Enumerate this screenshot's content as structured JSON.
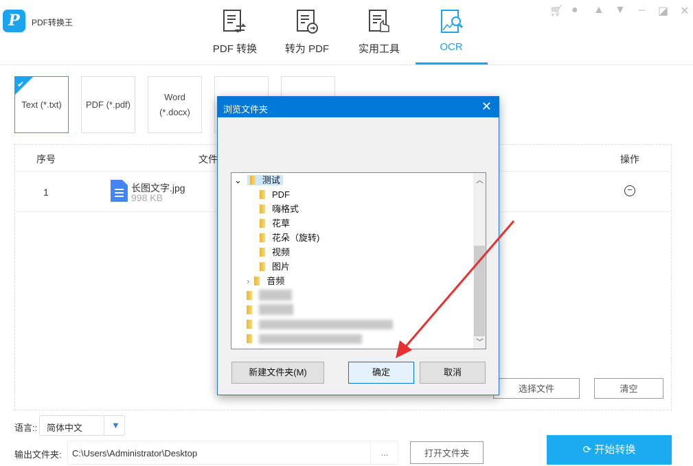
{
  "app": {
    "name": "PDF转换王",
    "logo_letter": "P"
  },
  "nav": [
    {
      "label": "PDF 转换"
    },
    {
      "label": "转为 PDF"
    },
    {
      "label": "实用工具"
    },
    {
      "label": "OCR",
      "active": true
    }
  ],
  "window_controls": [
    "cart-icon",
    "user-icon",
    "bell-icon",
    "menu-icon",
    "minimize-icon",
    "restore-icon",
    "close-icon"
  ],
  "formats": [
    {
      "label": "Text (*.txt)",
      "selected": true
    },
    {
      "label": "PDF (*.pdf)"
    },
    {
      "label": "Word\n(*.docx)"
    }
  ],
  "table": {
    "headers": {
      "index": "序号",
      "file": "文件",
      "action": "操作"
    },
    "rows": [
      {
        "index": "1",
        "name": "长图文字.jpg",
        "size": "998 KB"
      }
    ]
  },
  "buttons": {
    "select_file": "选择文件",
    "clear": "清空",
    "open_folder": "打开文件夹",
    "start": "开始转换",
    "browse": "..."
  },
  "language": {
    "label": "语言::",
    "value": "简体中文"
  },
  "output": {
    "label": "输出文件夹:",
    "path": "C:\\Users\\Administrator\\Desktop"
  },
  "dialog": {
    "title": "浏览文件夹",
    "close": "✕",
    "tree": [
      {
        "label": "测试",
        "expanded": true,
        "selected": true
      },
      {
        "label": "PDF"
      },
      {
        "label": "嗨格式"
      },
      {
        "label": "花草"
      },
      {
        "label": "花朵（旋转)"
      },
      {
        "label": "视频"
      },
      {
        "label": "图片"
      },
      {
        "label": "音频",
        "collapsed": true
      }
    ],
    "new_folder": "新建文件夹(M)",
    "ok": "确定",
    "cancel": "取消"
  },
  "colors": {
    "accent": "#1aa3f0",
    "dialog_title": "#0078d7",
    "arrow": "#e83030"
  }
}
